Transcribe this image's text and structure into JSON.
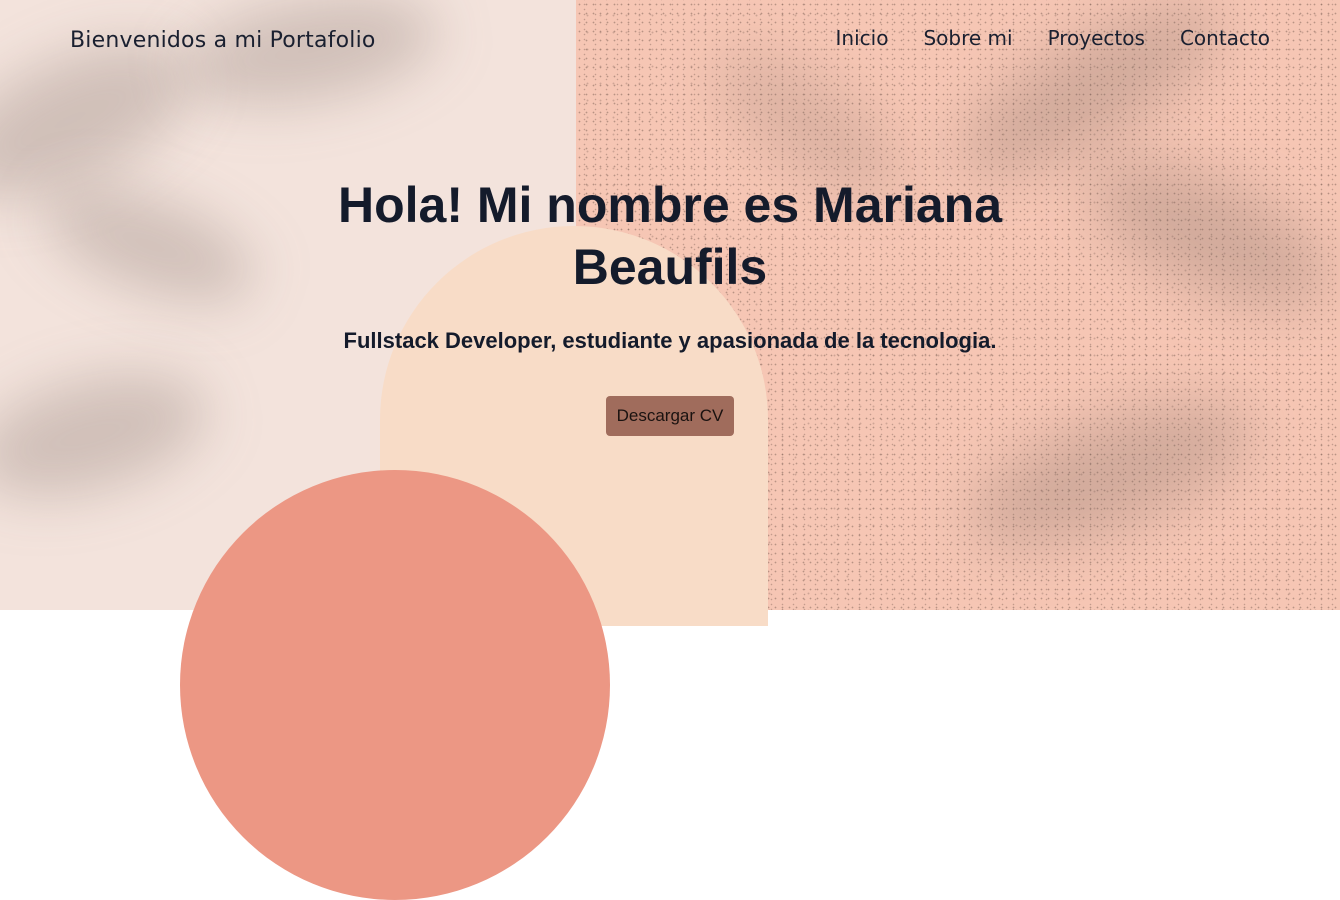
{
  "header": {
    "brand": "Bienvenidos a mi Portafolio",
    "nav": [
      {
        "label": "Inicio"
      },
      {
        "label": "Sobre mi"
      },
      {
        "label": "Proyectos"
      },
      {
        "label": "Contacto"
      }
    ]
  },
  "hero": {
    "title": "Hola! Mi nombre es Mariana Beaufils",
    "subtitle": "Fullstack Developer, estudiante y apasionada de la tecnologia.",
    "cta_label": "Descargar CV"
  },
  "colors": {
    "left_bg": "#f3e3dc",
    "right_bg": "#f6c6b4",
    "arch": "#f8dcc7",
    "circle": "#ec9784",
    "button": "#a06c5c",
    "text": "#141b2b"
  }
}
